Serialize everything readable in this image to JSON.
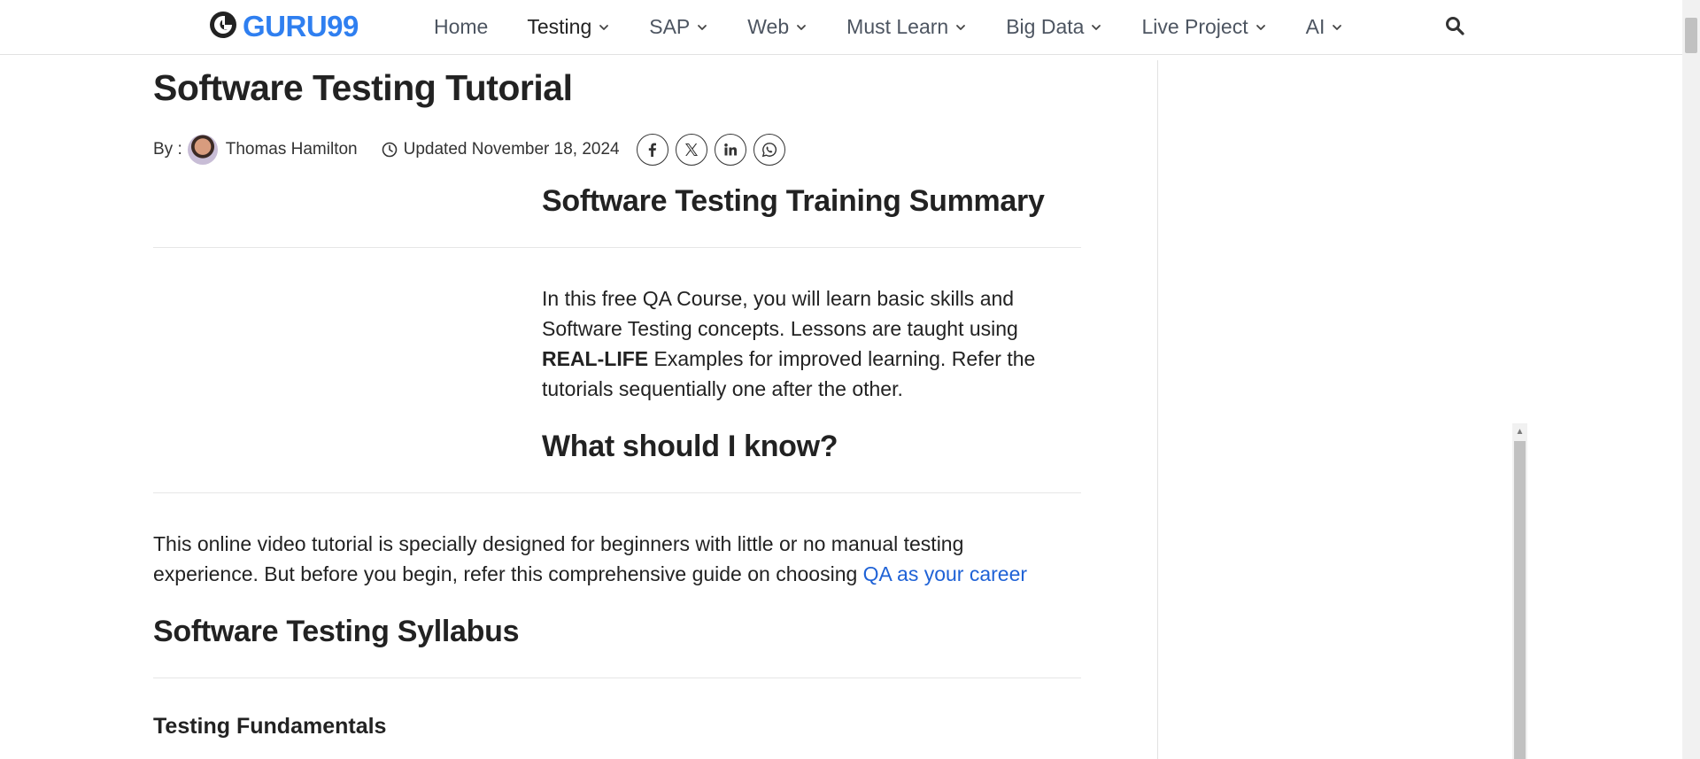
{
  "header": {
    "logo_text": "GURU99",
    "nav": [
      {
        "label": "Home",
        "dropdown": false
      },
      {
        "label": "Testing",
        "dropdown": true
      },
      {
        "label": "SAP",
        "dropdown": true
      },
      {
        "label": "Web",
        "dropdown": true
      },
      {
        "label": "Must Learn",
        "dropdown": true
      },
      {
        "label": "Big Data",
        "dropdown": true
      },
      {
        "label": "Live Project",
        "dropdown": true
      },
      {
        "label": "AI",
        "dropdown": true
      }
    ],
    "active_nav": "Testing",
    "search_icon": "search-icon"
  },
  "article": {
    "title": "Software Testing Tutorial",
    "by_label": "By :",
    "author": "Thomas Hamilton",
    "updated": "Updated November 18, 2024",
    "share_icons": [
      "facebook-icon",
      "x-twitter-icon",
      "linkedin-icon",
      "whatsapp-icon"
    ],
    "summary_heading": "Software Testing Training Summary",
    "summary": {
      "before": "In this free QA Course, you will learn basic skills and Software Testing concepts. Lessons are taught using ",
      "bold": "REAL-LIFE",
      "after": " Examples for improved learning. Refer the tutorials sequentially one after the other."
    },
    "know_heading": "What should I know?",
    "know": {
      "text": "This online video tutorial is specially designed for beginners with little or no manual testing experience. But before you begin, refer this comprehensive guide on choosing ",
      "link": "QA as your career"
    },
    "syllabus_heading": "Software Testing Syllabus",
    "first_section": "Testing Fundamentals"
  },
  "colors": {
    "brand_blue": "#2f7ff0",
    "link_blue": "#1f62d6",
    "text": "#222222",
    "nav_text": "#4d5561"
  }
}
